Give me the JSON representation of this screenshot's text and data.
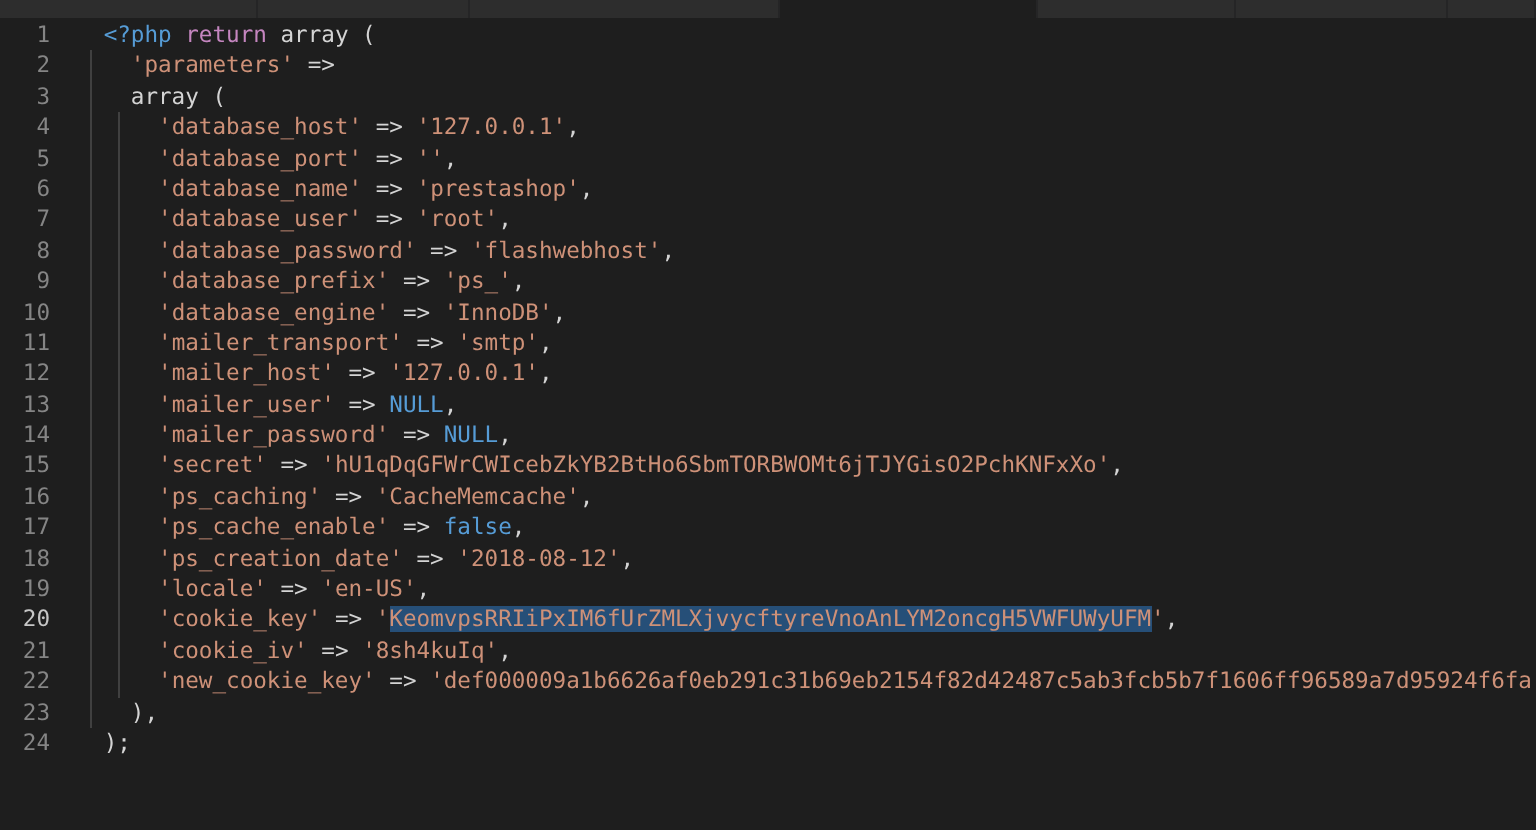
{
  "tabs": [
    {
      "selected": false
    },
    {
      "selected": false
    },
    {
      "selected": false
    },
    {
      "selected": true
    },
    {
      "selected": false
    },
    {
      "selected": false
    },
    {
      "selected": false
    }
  ],
  "lines": [
    {
      "number": "1",
      "current": false,
      "tokens": [
        {
          "kind": "tag",
          "text": "<?php"
        },
        {
          "kind": "keyword",
          "text": " return"
        },
        {
          "kind": "plain",
          "text": " array ("
        }
      ],
      "children": [
        {
          "number": "2",
          "current": false,
          "tokens": [
            {
              "kind": "string",
              "text": "'parameters'"
            },
            {
              "kind": "plain",
              "text": " =>"
            }
          ]
        },
        {
          "number": "3",
          "current": false,
          "tokens": [
            {
              "kind": "plain",
              "text": "array ("
            }
          ],
          "children": [
            {
              "number": "4",
              "current": false,
              "tokens": [
                {
                  "kind": "string",
                  "text": "'database_host'"
                },
                {
                  "kind": "plain",
                  "text": " => "
                },
                {
                  "kind": "string",
                  "text": "'127.0.0.1'"
                },
                {
                  "kind": "plain",
                  "text": ","
                }
              ]
            },
            {
              "number": "5",
              "current": false,
              "tokens": [
                {
                  "kind": "string",
                  "text": "'database_port'"
                },
                {
                  "kind": "plain",
                  "text": " => "
                },
                {
                  "kind": "string",
                  "text": "''"
                },
                {
                  "kind": "plain",
                  "text": ","
                }
              ]
            },
            {
              "number": "6",
              "current": false,
              "tokens": [
                {
                  "kind": "string",
                  "text": "'database_name'"
                },
                {
                  "kind": "plain",
                  "text": " => "
                },
                {
                  "kind": "string",
                  "text": "'prestashop'"
                },
                {
                  "kind": "plain",
                  "text": ","
                }
              ]
            },
            {
              "number": "7",
              "current": false,
              "tokens": [
                {
                  "kind": "string",
                  "text": "'database_user'"
                },
                {
                  "kind": "plain",
                  "text": " => "
                },
                {
                  "kind": "string",
                  "text": "'root'"
                },
                {
                  "kind": "plain",
                  "text": ","
                }
              ]
            },
            {
              "number": "8",
              "current": false,
              "tokens": [
                {
                  "kind": "string",
                  "text": "'database_password'"
                },
                {
                  "kind": "plain",
                  "text": " => "
                },
                {
                  "kind": "string",
                  "text": "'flashwebhost'"
                },
                {
                  "kind": "plain",
                  "text": ","
                }
              ]
            },
            {
              "number": "9",
              "current": false,
              "tokens": [
                {
                  "kind": "string",
                  "text": "'database_prefix'"
                },
                {
                  "kind": "plain",
                  "text": " => "
                },
                {
                  "kind": "string",
                  "text": "'ps_'"
                },
                {
                  "kind": "plain",
                  "text": ","
                }
              ]
            },
            {
              "number": "10",
              "current": false,
              "tokens": [
                {
                  "kind": "string",
                  "text": "'database_engine'"
                },
                {
                  "kind": "plain",
                  "text": " => "
                },
                {
                  "kind": "string",
                  "text": "'InnoDB'"
                },
                {
                  "kind": "plain",
                  "text": ","
                }
              ]
            },
            {
              "number": "11",
              "current": false,
              "tokens": [
                {
                  "kind": "string",
                  "text": "'mailer_transport'"
                },
                {
                  "kind": "plain",
                  "text": " => "
                },
                {
                  "kind": "string",
                  "text": "'smtp'"
                },
                {
                  "kind": "plain",
                  "text": ","
                }
              ]
            },
            {
              "number": "12",
              "current": false,
              "tokens": [
                {
                  "kind": "string",
                  "text": "'mailer_host'"
                },
                {
                  "kind": "plain",
                  "text": " => "
                },
                {
                  "kind": "string",
                  "text": "'127.0.0.1'"
                },
                {
                  "kind": "plain",
                  "text": ","
                }
              ]
            },
            {
              "number": "13",
              "current": false,
              "tokens": [
                {
                  "kind": "string",
                  "text": "'mailer_user'"
                },
                {
                  "kind": "plain",
                  "text": " => "
                },
                {
                  "kind": "constant",
                  "text": "NULL"
                },
                {
                  "kind": "plain",
                  "text": ","
                }
              ]
            },
            {
              "number": "14",
              "current": false,
              "tokens": [
                {
                  "kind": "string",
                  "text": "'mailer_password'"
                },
                {
                  "kind": "plain",
                  "text": " => "
                },
                {
                  "kind": "constant",
                  "text": "NULL"
                },
                {
                  "kind": "plain",
                  "text": ","
                }
              ]
            },
            {
              "number": "15",
              "current": false,
              "tokens": [
                {
                  "kind": "string",
                  "text": "'secret'"
                },
                {
                  "kind": "plain",
                  "text": " => "
                },
                {
                  "kind": "string",
                  "text": "'hU1qDqGFWrCWIcebZkYB2BtHo6SbmTORBWOMt6jTJYGisO2PchKNFxXo'"
                },
                {
                  "kind": "plain",
                  "text": ","
                }
              ]
            },
            {
              "number": "16",
              "current": false,
              "tokens": [
                {
                  "kind": "string",
                  "text": "'ps_caching'"
                },
                {
                  "kind": "plain",
                  "text": " => "
                },
                {
                  "kind": "string",
                  "text": "'CacheMemcache'"
                },
                {
                  "kind": "plain",
                  "text": ","
                }
              ]
            },
            {
              "number": "17",
              "current": false,
              "tokens": [
                {
                  "kind": "string",
                  "text": "'ps_cache_enable'"
                },
                {
                  "kind": "plain",
                  "text": " => "
                },
                {
                  "kind": "constant",
                  "text": "false"
                },
                {
                  "kind": "plain",
                  "text": ","
                }
              ]
            },
            {
              "number": "18",
              "current": false,
              "tokens": [
                {
                  "kind": "string",
                  "text": "'ps_creation_date'"
                },
                {
                  "kind": "plain",
                  "text": " => "
                },
                {
                  "kind": "string",
                  "text": "'2018-08-12'"
                },
                {
                  "kind": "plain",
                  "text": ","
                }
              ]
            },
            {
              "number": "19",
              "current": false,
              "tokens": [
                {
                  "kind": "string",
                  "text": "'locale'"
                },
                {
                  "kind": "plain",
                  "text": " => "
                },
                {
                  "kind": "string",
                  "text": "'en-US'"
                },
                {
                  "kind": "plain",
                  "text": ","
                }
              ]
            },
            {
              "number": "20",
              "current": true,
              "tokens": [
                {
                  "kind": "string",
                  "text": "'cookie_key'"
                },
                {
                  "kind": "plain",
                  "text": " => "
                },
                {
                  "kind": "string",
                  "text": "'"
                },
                {
                  "kind": "selection",
                  "text": "KeomvpsRRIiPxIM6fUrZMLXjvycftyreVnoAnLYM2oncgH5VWFUWyUFM"
                },
                {
                  "kind": "string",
                  "text": "'"
                },
                {
                  "kind": "plain",
                  "text": ","
                }
              ]
            },
            {
              "number": "21",
              "current": false,
              "tokens": [
                {
                  "kind": "string",
                  "text": "'cookie_iv'"
                },
                {
                  "kind": "plain",
                  "text": " => "
                },
                {
                  "kind": "string",
                  "text": "'8sh4kuIq'"
                },
                {
                  "kind": "plain",
                  "text": ","
                }
              ]
            },
            {
              "number": "22",
              "current": false,
              "tokens": [
                {
                  "kind": "string",
                  "text": "'new_cookie_key'"
                },
                {
                  "kind": "plain",
                  "text": " => "
                },
                {
                  "kind": "string",
                  "text": "'def000009a1b6626af0eb291c31b69eb2154f82d42487c5ab3fcb5b7f1606ff96589a7d95924f6fa"
                }
              ]
            }
          ]
        },
        {
          "number": "23",
          "current": false,
          "tokens": [
            {
              "kind": "plain",
              "text": "),"
            }
          ]
        }
      ]
    },
    {
      "number": "24",
      "current": false,
      "tokens": [
        {
          "kind": "plain",
          "text": ");"
        }
      ]
    }
  ]
}
